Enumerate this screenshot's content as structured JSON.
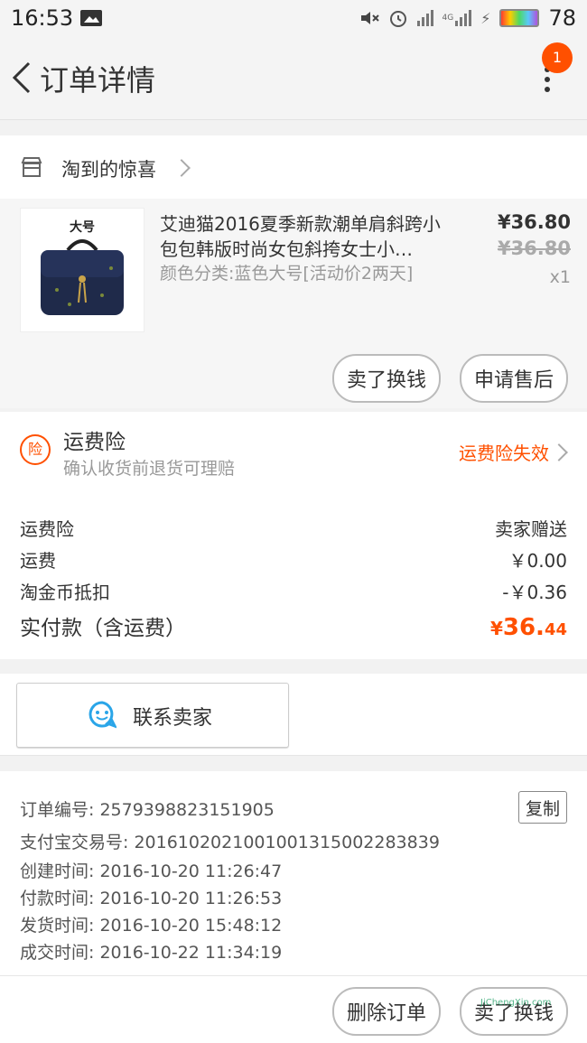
{
  "status_bar": {
    "time": "16:53",
    "battery": "78",
    "network": "4G"
  },
  "nav": {
    "title": "订单详情",
    "badge_count": "1"
  },
  "shop": {
    "name": "淘到的惊喜"
  },
  "item": {
    "title": "艾迪猫2016夏季新款潮单肩斜跨小包包韩版时尚女包斜挎女士小…",
    "sku": "颜色分类:蓝色大号[活动价2两天]",
    "price": "¥36.80",
    "original_price": "¥36.80",
    "quantity": "x1",
    "thumb_label": "大号"
  },
  "item_actions": {
    "resell": "卖了换钱",
    "after_sale": "申请售后"
  },
  "insurance": {
    "badge": "险",
    "title": "运费险",
    "subtitle": "确认收货前退货可理赔",
    "status": "运费险失效"
  },
  "fees": {
    "rows": [
      {
        "label": "运费险",
        "value": "卖家赠送"
      },
      {
        "label": "运费",
        "value": "￥0.00"
      },
      {
        "label": "淘金币抵扣",
        "value": "-￥0.36"
      }
    ],
    "total_label": "实付款（含运费）",
    "total_currency": "¥",
    "total_int": "36.",
    "total_dec": "44"
  },
  "contact": {
    "label": "联系卖家"
  },
  "order_info": {
    "lines": [
      "订单编号: 2579398823151905",
      "支付宝交易号: 2016102021001001315002283839",
      "创建时间: 2016-10-20 11:26:47",
      "付款时间: 2016-10-20 11:26:53",
      "发货时间: 2016-10-20 15:48:12",
      "成交时间: 2016-10-22 11:34:19"
    ],
    "copy_label": "复制"
  },
  "bottom_actions": {
    "delete": "删除订单",
    "resell": "卖了换钱"
  },
  "watermark": "JiChengXin.com",
  "colors": {
    "accent": "#ff5000",
    "badge": "#ff5000"
  }
}
